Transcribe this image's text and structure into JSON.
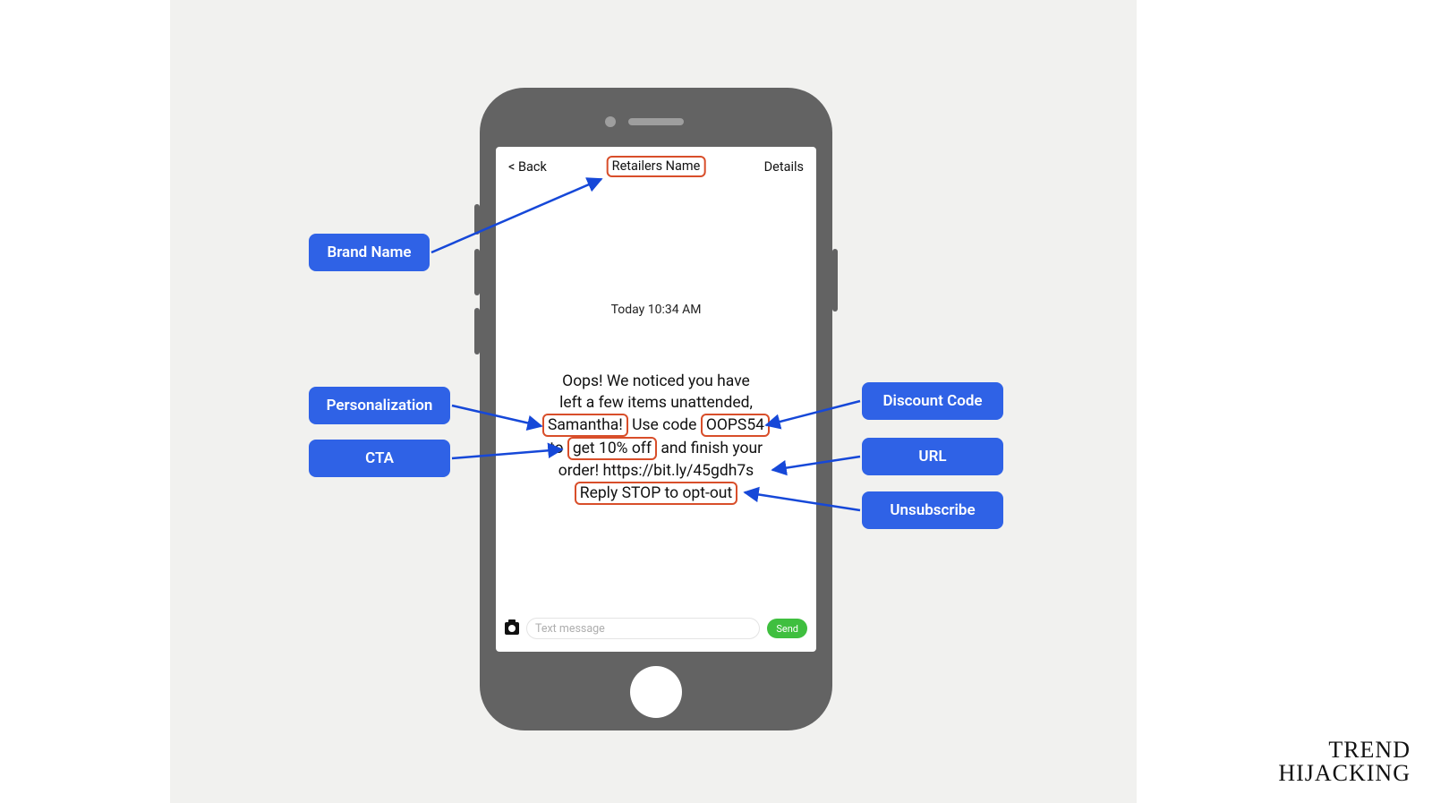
{
  "phone": {
    "back_label": "< Back",
    "title": "Retailers Name",
    "details_label": "Details",
    "timestamp": "Today 10:34 AM",
    "input_placeholder": "Text message",
    "send_label": "Send",
    "message": {
      "line1": "Oops! We noticed you have",
      "line2": "left a few items unattended,",
      "name": "Samantha!",
      "mid3": " Use code ",
      "code": "OOPS54",
      "pre4": "to ",
      "cta": "get 10% off",
      "post4": " and finish your",
      "line5a": "order! ",
      "url": "https://bit.ly/45gdh7s",
      "unsub": "Reply STOP to opt-out"
    }
  },
  "callouts": {
    "brand_name": "Brand Name",
    "personalization": "Personalization",
    "cta": "CTA",
    "discount_code": "Discount Code",
    "url": "URL",
    "unsubscribe": "Unsubscribe"
  },
  "footer": {
    "line1": "TREND",
    "line2": "HIJACKING"
  }
}
